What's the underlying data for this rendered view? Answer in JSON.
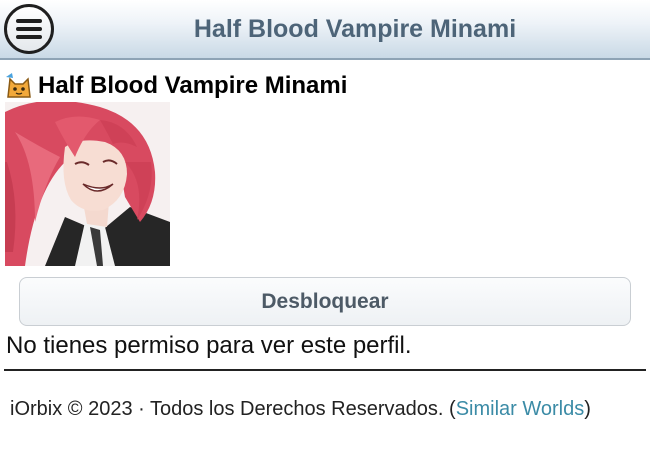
{
  "header": {
    "title": "Half Blood Vampire Minami",
    "menu_icon": "hamburger-menu-icon"
  },
  "profile": {
    "rank_icon": "cat-badge-icon",
    "name": "Half Blood Vampire Minami"
  },
  "actions": {
    "unlock_label": "Desbloquear"
  },
  "messages": {
    "no_permission": "No tienes permiso para ver este perfil."
  },
  "footer": {
    "copyright": "iOrbix © 2023 · Todos los Derechos Reservados. (",
    "link_label": "Similar Worlds",
    "closing": ")"
  },
  "colors": {
    "header_title": "#4d6478",
    "link": "#3b8ba6",
    "button_text": "#4d5a66"
  }
}
